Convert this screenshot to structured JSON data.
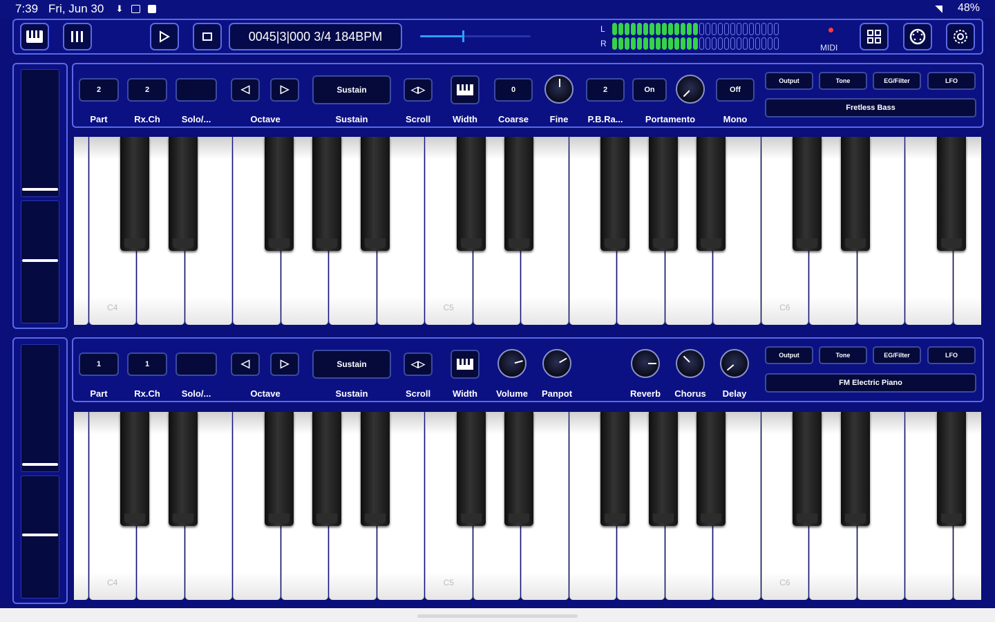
{
  "status": {
    "time": "7:39",
    "date": "Fri, Jun 30",
    "battery": "48%"
  },
  "toolbar": {
    "position": "0045|3|000 3/4 184BPM",
    "tempo_slider_fraction": 0.38,
    "meter_left_label": "L",
    "meter_right_label": "R",
    "meter_left_active_segments": 14,
    "meter_right_active_segments": 14,
    "meter_total_segments": 27,
    "midi_label": "MIDI"
  },
  "upper": {
    "part": "2",
    "rx_ch": "2",
    "solo": "",
    "sustain": "Sustain",
    "coarse": "0",
    "pb_range": "2",
    "portamento_value": "On",
    "mono": "Off",
    "labels": {
      "part": "Part",
      "rx_ch": "Rx.Ch",
      "solo": "Solo/...",
      "octave": "Octave",
      "sustain": "Sustain",
      "scroll": "Scroll",
      "width": "Width",
      "coarse": "Coarse",
      "fine": "Fine",
      "pb_range": "P.B.Ra...",
      "portamento": "Portamento",
      "mono": "Mono"
    },
    "tabs": [
      "Output",
      "Tone",
      "EG/Filter",
      "LFO"
    ],
    "instrument": "Fretless Bass",
    "notes": [
      "C4",
      "C5",
      "C6"
    ]
  },
  "lower": {
    "part": "1",
    "rx_ch": "1",
    "solo": "",
    "sustain": "Sustain",
    "labels": {
      "part": "Part",
      "rx_ch": "Rx.Ch",
      "solo": "Solo/...",
      "octave": "Octave",
      "sustain": "Sustain",
      "scroll": "Scroll",
      "width": "Width",
      "volume": "Volume",
      "panpot": "Panpot",
      "reverb": "Reverb",
      "chorus": "Chorus",
      "delay": "Delay"
    },
    "tabs": [
      "Output",
      "Tone",
      "EG/Filter",
      "LFO"
    ],
    "instrument": "FM Electric Piano",
    "notes": [
      "C4",
      "C5",
      "C6"
    ]
  }
}
